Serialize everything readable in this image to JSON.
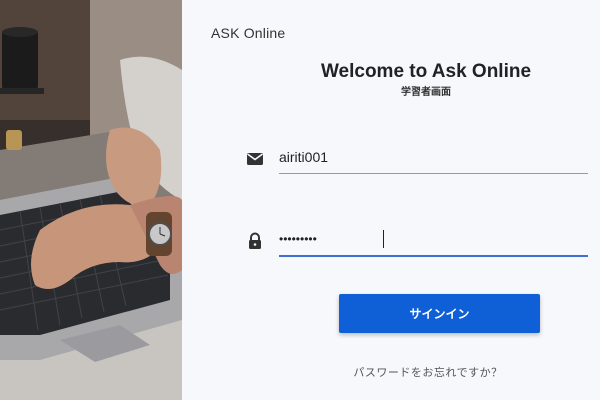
{
  "brand": {
    "name": "ASK Online"
  },
  "welcome": {
    "title": "Welcome to Ask Online",
    "subtitle": "学習者画面"
  },
  "login_form": {
    "email": {
      "icon": "envelope-icon",
      "value": "airiti001"
    },
    "password": {
      "icon": "lock-icon",
      "value": "•••••••••"
    },
    "signin_label": "サインイン",
    "forgot_password_label": "パスワードをお忘れですか？"
  },
  "hero": {
    "image": "hands-typing-on-laptop-with-coffee-cup"
  },
  "colors": {
    "accent": "#0f5fd6",
    "panel_background": "#f7f8fc",
    "active_underline": "#3f6fd1"
  }
}
